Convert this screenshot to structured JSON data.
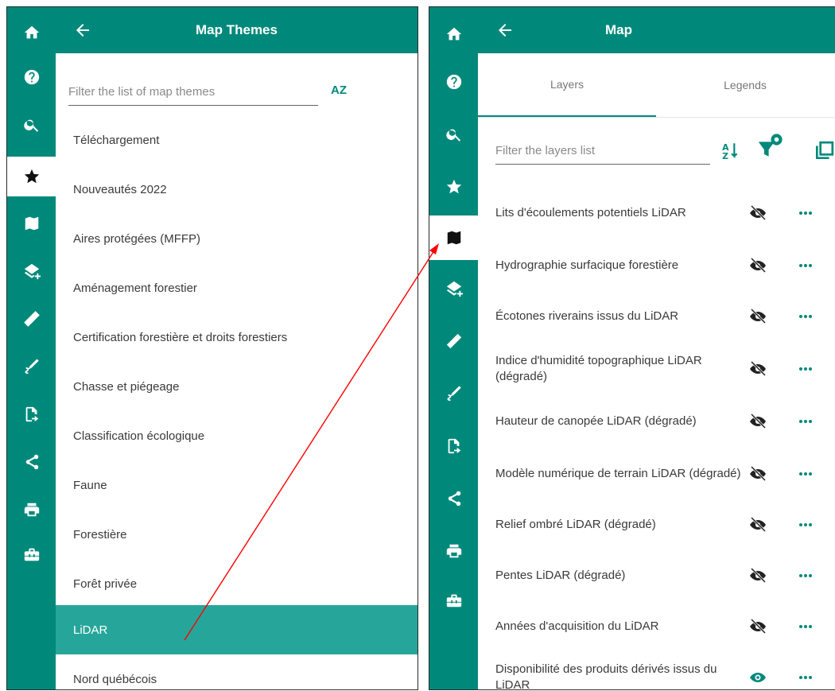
{
  "left_panel": {
    "title": "Map Themes",
    "filter_placeholder": "Filter the list of map themes",
    "sort_label": "AZ",
    "themes": [
      "Téléchargement",
      "Nouveautés 2022",
      "Aires protégées (MFFP)",
      "Aménagement forestier",
      "Certification forestière et droits forestiers",
      "Chasse et piégeage",
      "Classification écologique",
      "Faune",
      "Forestière",
      "Forêt privée",
      "LiDAR",
      "Nord québécois"
    ],
    "selected_theme": "LiDAR"
  },
  "right_panel": {
    "title": "Map",
    "tabs": [
      "Layers",
      "Legends"
    ],
    "active_tab": "Layers",
    "filter_placeholder": "Filter the layers list",
    "layers": [
      {
        "name": "Lits d'écoulements potentiels LiDAR",
        "visible": false
      },
      {
        "name": "Hydrographie surfacique forestière",
        "visible": false
      },
      {
        "name": "Écotones riverains issus du LiDAR",
        "visible": false
      },
      {
        "name": "Indice d'humidité topographique LiDAR (dégradé)",
        "visible": false
      },
      {
        "name": "Hauteur de canopée LiDAR (dégradé)",
        "visible": false
      },
      {
        "name": "Modèle numérique de terrain LiDAR (dégradé)",
        "visible": false
      },
      {
        "name": "Relief ombré LiDAR (dégradé)",
        "visible": false
      },
      {
        "name": "Pentes LiDAR (dégradé)",
        "visible": false
      },
      {
        "name": "Années d'acquisition du LiDAR",
        "visible": false
      },
      {
        "name": "Disponibilité des produits dérivés issus du LiDAR",
        "visible": true
      }
    ]
  },
  "rail_icons": [
    "home-icon",
    "help-icon",
    "search-icon",
    "star-icon",
    "map-icon",
    "add-layer-icon",
    "ruler-icon",
    "draw-icon",
    "export-icon",
    "share-icon",
    "print-icon",
    "toolbox-icon"
  ],
  "colors": {
    "primary": "#00897b",
    "selected": "#26a69a",
    "annotation_arrow": "#ff0000"
  }
}
